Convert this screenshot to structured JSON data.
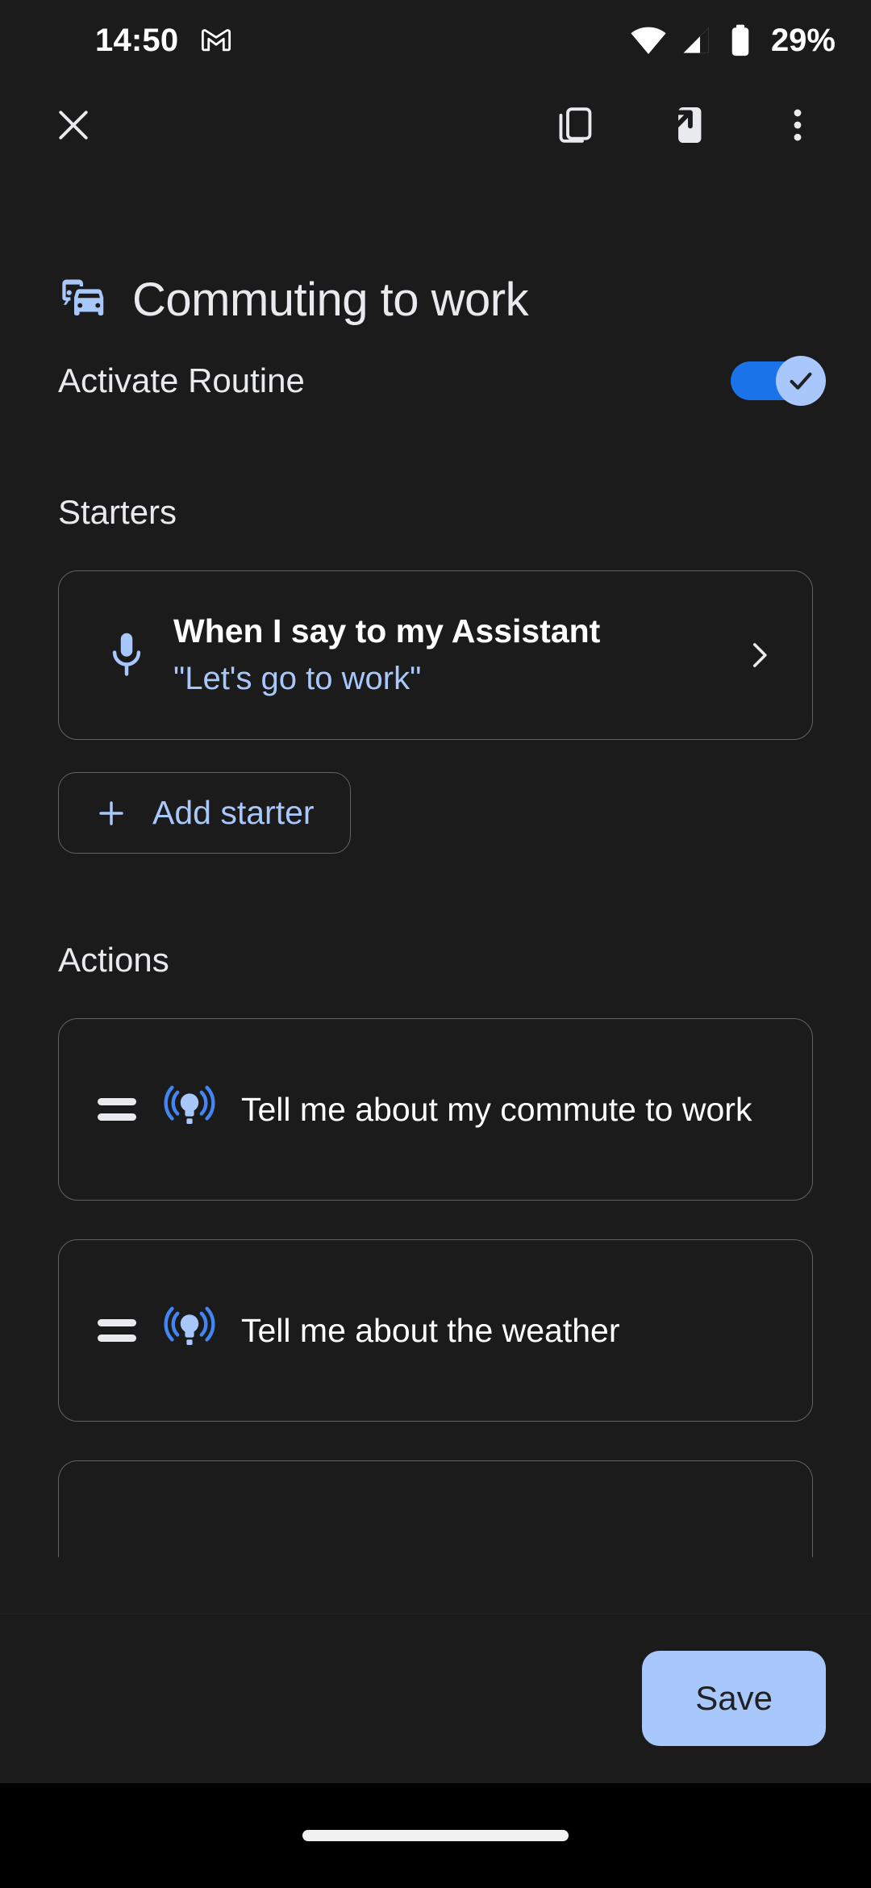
{
  "status_bar": {
    "time": "14:50",
    "notification_icon": "gmail-icon",
    "wifi_icon": "wifi-icon",
    "signal_icon": "cellular-signal-icon",
    "battery_icon": "battery-icon",
    "battery_percent": "29%"
  },
  "toolbar": {
    "close_icon": "close-icon",
    "duplicate_icon": "duplicate-routine-icon",
    "send_to_device_icon": "send-to-device-icon",
    "overflow_icon": "more-options-icon"
  },
  "routine": {
    "icon": "commute-icon",
    "title": "Commuting to work",
    "activate_label": "Activate Routine",
    "activate_enabled": true,
    "toggle_check_icon": "check-icon"
  },
  "starters": {
    "section_label": "Starters",
    "items": [
      {
        "icon": "microphone-icon",
        "title": "When I say to my Assistant",
        "subtitle": "\"Let's go to work\"",
        "chevron_icon": "chevron-right-icon"
      }
    ],
    "add_button": {
      "icon": "plus-icon",
      "label": "Add starter"
    }
  },
  "actions": {
    "section_label": "Actions",
    "items": [
      {
        "drag_handle_icon": "drag-handle-icon",
        "icon": "assistant-broadcast-icon",
        "text": "Tell me about my commute to work"
      },
      {
        "drag_handle_icon": "drag-handle-icon",
        "icon": "assistant-broadcast-icon",
        "text": "Tell me about the weather"
      }
    ]
  },
  "bottom_bar": {
    "save_label": "Save"
  },
  "nav_bar": {
    "gesture_pill": "home-gesture-pill"
  },
  "colors": {
    "background": "#1b1b1b",
    "accent_blue": "#a8c7fa",
    "toggle_track": "#1a73e8",
    "text_primary": "#e8eaed",
    "outline": "#5f6368",
    "nav_background": "#000000"
  }
}
